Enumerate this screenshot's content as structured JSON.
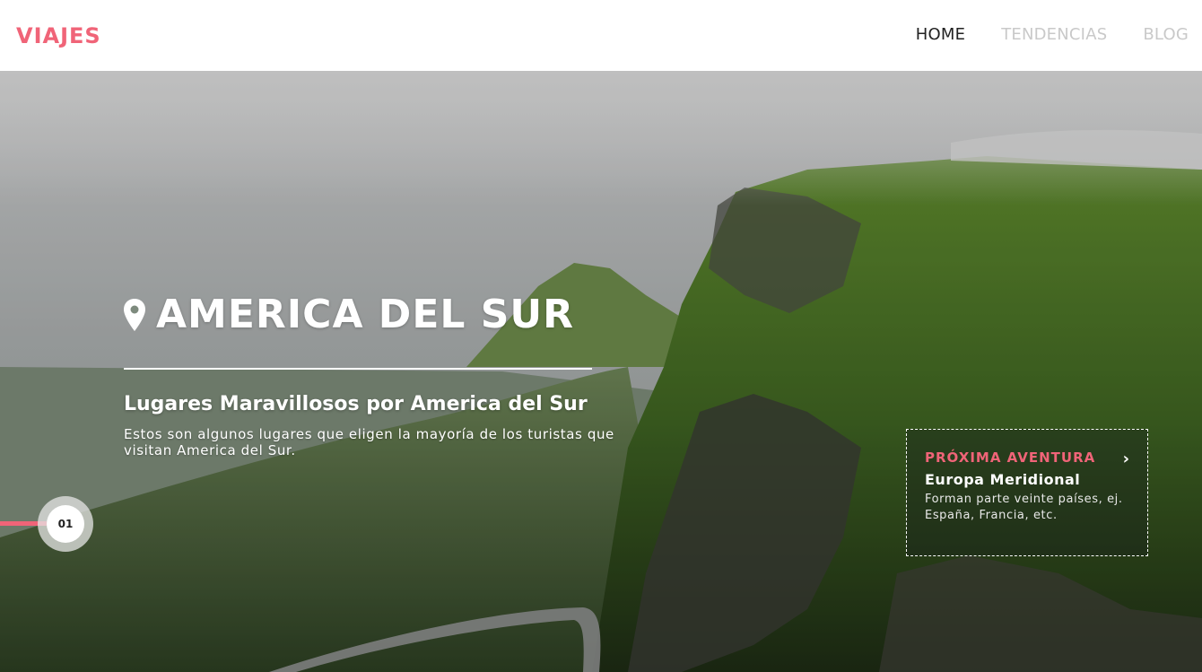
{
  "colors": {
    "accent": "#f06478",
    "nav_active": "#222222",
    "nav_inactive": "#c9c9c9"
  },
  "header": {
    "logo": "VIAJES",
    "nav": [
      {
        "label": "HOME",
        "active": true
      },
      {
        "label": "TENDENCIAS",
        "active": false
      },
      {
        "label": "BLOG",
        "active": false
      }
    ]
  },
  "hero": {
    "icon": "location-pin-icon",
    "title": "AMERICA DEL SUR",
    "subtitle": "Lugares Maravillosos por America del Sur",
    "description": "Estos son algunos lugares que eligen la mayoría de los turistas que visitan America del Sur.",
    "slide_number": "01"
  },
  "next_adventure": {
    "label": "PRÓXIMA AVENTURA",
    "icon": "chevron-right-icon",
    "title": "Europa Meridional",
    "description": "Forman parte veinte países, ej. España, Francia, etc."
  }
}
